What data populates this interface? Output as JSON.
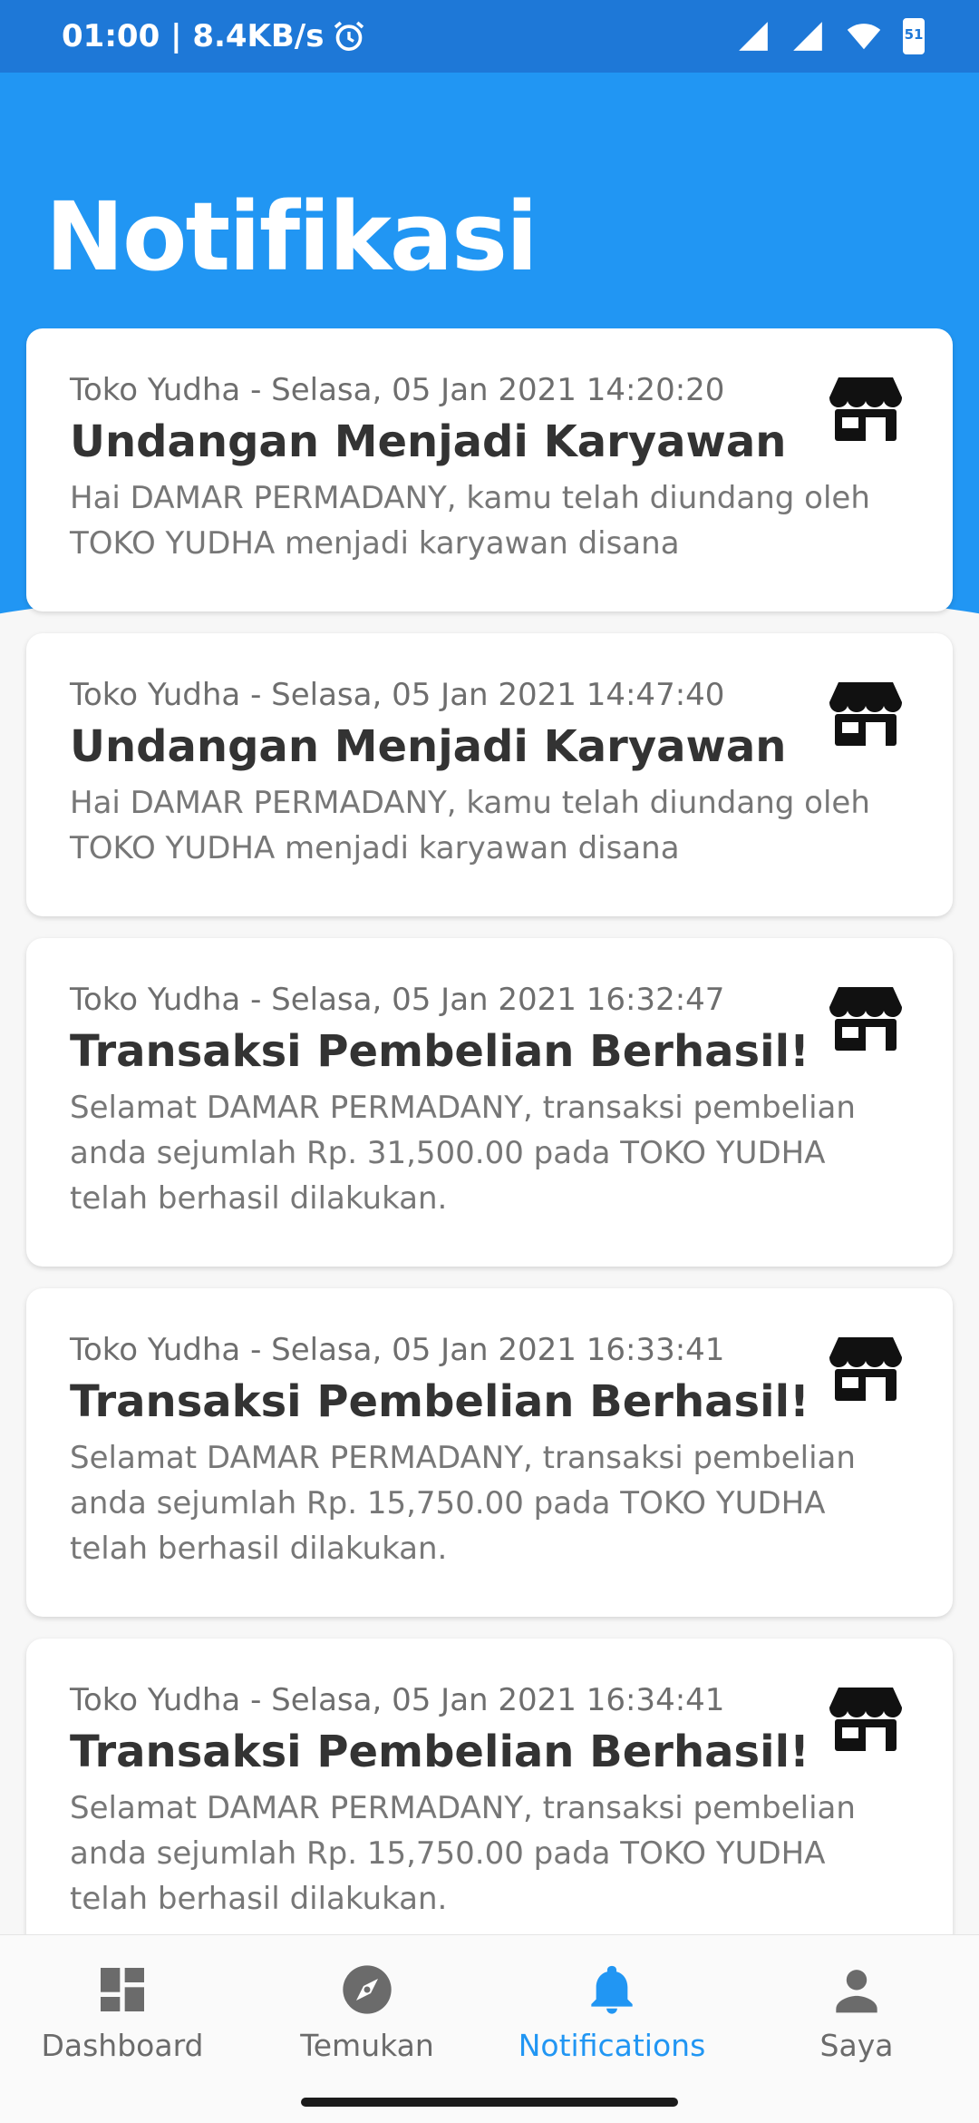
{
  "status_bar": {
    "time_speed": "01:00 | 8.4KB/s",
    "battery_level": "51"
  },
  "header": {
    "title": "Notifikasi",
    "color": "#2196f3"
  },
  "notifications": [
    {
      "meta": "Toko Yudha - Selasa, 05 Jan 2021 14:20:20",
      "title": "Undangan Menjadi Karyawan",
      "body": "Hai DAMAR PERMADANY, kamu telah diundang oleh TOKO YUDHA menjadi karyawan disana",
      "icon": "shop-icon"
    },
    {
      "meta": "Toko Yudha - Selasa, 05 Jan 2021 14:47:40",
      "title": "Undangan Menjadi Karyawan",
      "body": "Hai DAMAR PERMADANY, kamu telah diundang oleh TOKO YUDHA menjadi karyawan disana",
      "icon": "shop-icon"
    },
    {
      "meta": "Toko Yudha - Selasa, 05 Jan 2021 16:32:47",
      "title": "Transaksi Pembelian Berhasil!",
      "body": "Selamat DAMAR PERMADANY, transaksi pembelian anda sejumlah Rp. 31,500.00 pada TOKO YUDHA telah berhasil dilakukan.",
      "icon": "shop-icon"
    },
    {
      "meta": "Toko Yudha - Selasa, 05 Jan 2021 16:33:41",
      "title": "Transaksi Pembelian Berhasil!",
      "body": "Selamat DAMAR PERMADANY, transaksi pembelian anda sejumlah Rp. 15,750.00 pada TOKO YUDHA telah berhasil dilakukan.",
      "icon": "shop-icon"
    },
    {
      "meta": "Toko Yudha - Selasa, 05 Jan 2021 16:34:41",
      "title": "Transaksi Pembelian Berhasil!",
      "body": "Selamat DAMAR PERMADANY, transaksi pembelian anda sejumlah Rp. 15,750.00 pada TOKO YUDHA telah berhasil dilakukan.",
      "icon": "shop-icon"
    }
  ],
  "bottom_nav": {
    "items": [
      {
        "label": "Dashboard",
        "icon": "dashboard-icon",
        "active": false
      },
      {
        "label": "Temukan",
        "icon": "compass-icon",
        "active": false
      },
      {
        "label": "Notifications",
        "icon": "bell-icon",
        "active": true
      },
      {
        "label": "Saya",
        "icon": "person-icon",
        "active": false
      }
    ],
    "active_color": "#2196f3",
    "inactive_color": "#6b6b6b"
  }
}
